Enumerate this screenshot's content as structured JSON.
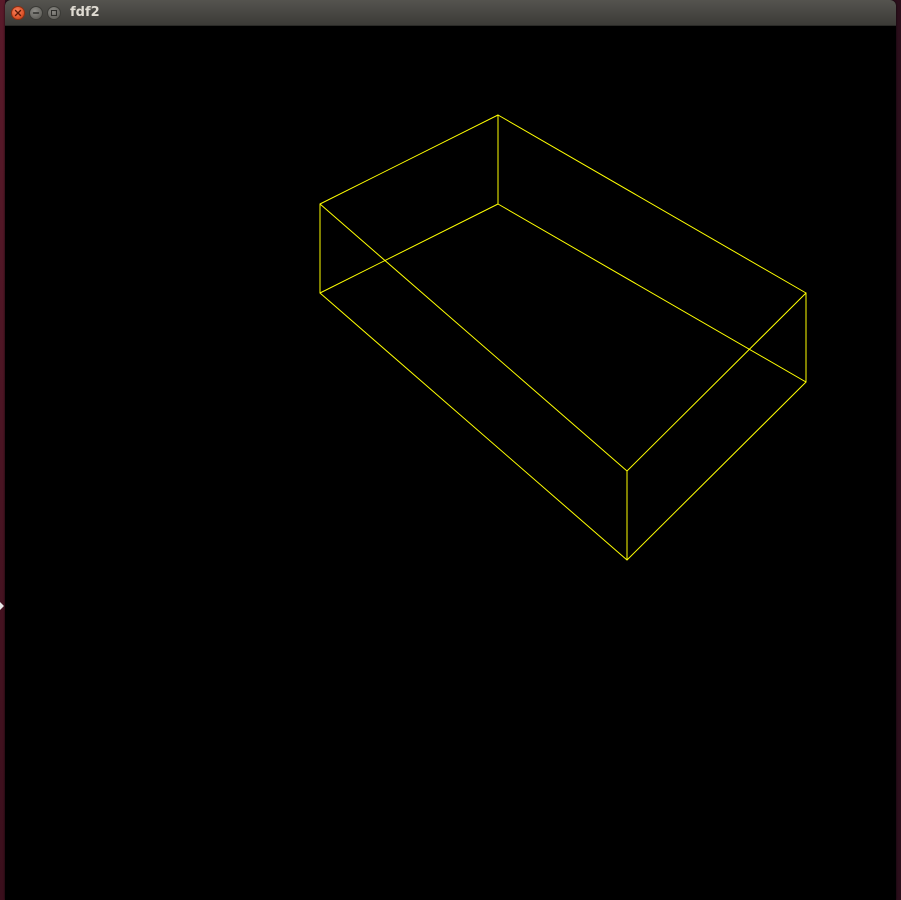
{
  "window": {
    "title": "fdf2",
    "controls": [
      {
        "name": "close-button",
        "icon": "close-icon"
      },
      {
        "name": "minimize-button",
        "icon": "minimize-icon"
      },
      {
        "name": "maximize-button",
        "icon": "maximize-icon"
      }
    ]
  },
  "colors": {
    "canvas_background": "#000000",
    "wireframe": "#ffff00",
    "close_button": "#e9592e",
    "titlebar": "#4a4945"
  }
}
